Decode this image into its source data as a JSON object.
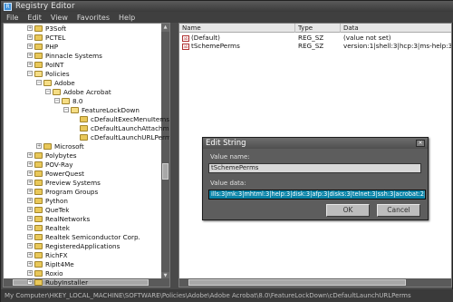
{
  "window": {
    "title": "Registry Editor"
  },
  "menu": [
    "File",
    "Edit",
    "View",
    "Favorites",
    "Help"
  ],
  "tree": [
    {
      "label": "P3Soft",
      "indent": 0
    },
    {
      "label": "PCTEL",
      "indent": 0
    },
    {
      "label": "PHP",
      "indent": 0
    },
    {
      "label": "Pinnacle Systems",
      "indent": 0
    },
    {
      "label": "PoINT",
      "indent": 0
    },
    {
      "label": "Policies",
      "indent": 0
    },
    {
      "label": "Adobe",
      "indent": 1
    },
    {
      "label": "Adobe Acrobat",
      "indent": 2
    },
    {
      "label": "8.0",
      "indent": 3
    },
    {
      "label": "FeatureLockDown",
      "indent": 4
    },
    {
      "label": "cDefaultExecMenuItems",
      "indent": 5
    },
    {
      "label": "cDefaultLaunchAttachme",
      "indent": 5
    },
    {
      "label": "cDefaultLaunchURLPerm",
      "indent": 5
    },
    {
      "label": "Microsoft",
      "indent": 1
    },
    {
      "label": "Polybytes",
      "indent": 0
    },
    {
      "label": "POV-Ray",
      "indent": 0
    },
    {
      "label": "PowerQuest",
      "indent": 0
    },
    {
      "label": "Preview Systems",
      "indent": 0
    },
    {
      "label": "Program Groups",
      "indent": 0
    },
    {
      "label": "Python",
      "indent": 0
    },
    {
      "label": "QueTek",
      "indent": 0
    },
    {
      "label": "RealNetworks",
      "indent": 0
    },
    {
      "label": "Realtek",
      "indent": 0
    },
    {
      "label": "Realtek Semiconductor Corp.",
      "indent": 0
    },
    {
      "label": "RegisteredApplications",
      "indent": 0
    },
    {
      "label": "RichFX",
      "indent": 0
    },
    {
      "label": "RipIt4Me",
      "indent": 0
    },
    {
      "label": "Roxio",
      "indent": 0
    },
    {
      "label": "RubyInstaller",
      "indent": 0
    }
  ],
  "list": {
    "columns": [
      "Name",
      "Type",
      "Data"
    ],
    "rows": [
      {
        "name": "(Default)",
        "type": "REG_SZ",
        "data": "(value not set)"
      },
      {
        "name": "tSchemePerms",
        "type": "REG_SZ",
        "data": "version:1|shell:3|hcp:3|ms-help:3|ms"
      }
    ]
  },
  "status": "My Computer\\HKEY_LOCAL_MACHINE\\SOFTWARE\\Policies\\Adobe\\Adobe Acrobat\\8.0\\FeatureLockDown\\cDefaultLaunchURLPerms",
  "dialog": {
    "title": "Edit String",
    "close": "×",
    "value_name_label": "Value name:",
    "value_name": "tSchemePerms",
    "value_data_label": "Value data:",
    "value_data": "ills:3|mk:3|mhtml:3|help:3|disk:3|afp:3|disks:3|telnet:3|ssh:3|acrobat:2|mailto:2|file:1",
    "ok": "OK",
    "cancel": "Cancel"
  }
}
